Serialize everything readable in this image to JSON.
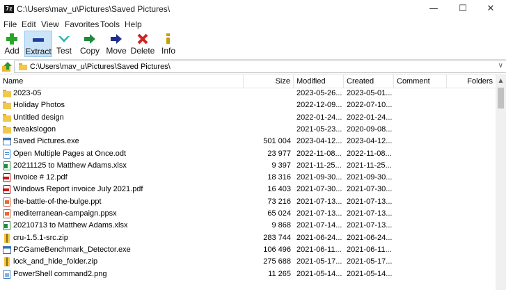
{
  "window": {
    "app_icon": "7z",
    "title": "C:\\Users\\mav_u\\Pictures\\Saved Pictures\\",
    "minimize": "—",
    "maximize": "☐",
    "close": "✕"
  },
  "menu": [
    "File",
    "Edit",
    "View",
    "Favorites",
    "Tools",
    "Help"
  ],
  "toolbar": [
    {
      "label": "Add",
      "icon": "add-icon",
      "color": "#2aa52a"
    },
    {
      "label": "Extract",
      "icon": "extract-icon",
      "color": "#1f3f9f",
      "selected": true
    },
    {
      "label": "Test",
      "icon": "test-icon",
      "color": "#23b5b5"
    },
    {
      "label": "Copy",
      "icon": "copy-icon",
      "color": "#1e8a3c"
    },
    {
      "label": "Move",
      "icon": "move-icon",
      "color": "#1f2f8f"
    },
    {
      "label": "Delete",
      "icon": "delete-icon",
      "color": "#d42020"
    },
    {
      "label": "Info",
      "icon": "info-icon",
      "color": "#c9a000"
    }
  ],
  "address": {
    "path": "C:\\Users\\mav_u\\Pictures\\Saved Pictures\\",
    "dropdown": "∨"
  },
  "columns": [
    "Name",
    "Size",
    "Modified",
    "Created",
    "Comment",
    "Folders"
  ],
  "files": [
    {
      "name": "2023-05",
      "size": "",
      "modified": "2023-05-26...",
      "created": "2023-05-01...",
      "type": "folder"
    },
    {
      "name": "Holiday Photos",
      "size": "",
      "modified": "2022-12-09...",
      "created": "2022-07-10...",
      "type": "folder"
    },
    {
      "name": "Untitled design",
      "size": "",
      "modified": "2022-01-24...",
      "created": "2022-01-24...",
      "type": "folder"
    },
    {
      "name": "tweakslogon",
      "size": "",
      "modified": "2021-05-23...",
      "created": "2020-09-08...",
      "type": "folder"
    },
    {
      "name": "Saved Pictures.exe",
      "size": "501 004",
      "modified": "2023-04-12...",
      "created": "2023-04-12...",
      "type": "exe"
    },
    {
      "name": "Open Multiple Pages at Once.odt",
      "size": "23 977",
      "modified": "2022-11-08...",
      "created": "2022-11-08...",
      "type": "odt"
    },
    {
      "name": "20211125 to Matthew Adams.xlsx",
      "size": "9 397",
      "modified": "2021-11-25...",
      "created": "2021-11-25...",
      "type": "xlsx"
    },
    {
      "name": "Invoice # 12.pdf",
      "size": "18 316",
      "modified": "2021-09-30...",
      "created": "2021-09-30...",
      "type": "pdf"
    },
    {
      "name": "Windows Report invoice July 2021.pdf",
      "size": "16 403",
      "modified": "2021-07-30...",
      "created": "2021-07-30...",
      "type": "pdf"
    },
    {
      "name": "the-battle-of-the-bulge.ppt",
      "size": "73 216",
      "modified": "2021-07-13...",
      "created": "2021-07-13...",
      "type": "ppt"
    },
    {
      "name": "mediterranean-campaign.ppsx",
      "size": "65 024",
      "modified": "2021-07-13...",
      "created": "2021-07-13...",
      "type": "ppt"
    },
    {
      "name": "20210713 to Matthew Adams.xlsx",
      "size": "9 868",
      "modified": "2021-07-14...",
      "created": "2021-07-13...",
      "type": "xlsx"
    },
    {
      "name": "cru-1.5.1-src.zip",
      "size": "283 744",
      "modified": "2021-06-24...",
      "created": "2021-06-24...",
      "type": "zip"
    },
    {
      "name": "PCGameBenchmark_Detector.exe",
      "size": "106 496",
      "modified": "2021-06-11...",
      "created": "2021-06-11...",
      "type": "exe"
    },
    {
      "name": "lock_and_hide_folder.zip",
      "size": "275 688",
      "modified": "2021-05-17...",
      "created": "2021-05-17...",
      "type": "zip"
    },
    {
      "name": "PowerShell command2.png",
      "size": "11 265",
      "modified": "2021-05-14...",
      "created": "2021-05-14...",
      "type": "png"
    }
  ],
  "scrollbar": {
    "up_arrow": "▲"
  }
}
